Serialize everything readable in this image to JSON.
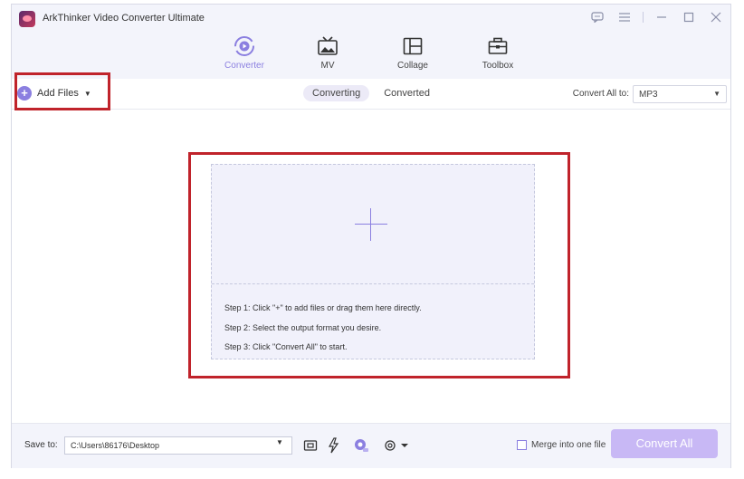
{
  "app": {
    "title": "ArkThinker Video Converter Ultimate"
  },
  "nav": {
    "tabs": [
      {
        "label": "Converter",
        "icon": "converter-icon",
        "active": true
      },
      {
        "label": "MV",
        "icon": "mv-icon",
        "active": false
      },
      {
        "label": "Collage",
        "icon": "collage-icon",
        "active": false
      },
      {
        "label": "Toolbox",
        "icon": "toolbox-icon",
        "active": false
      }
    ]
  },
  "toolbar": {
    "add_files_label": "Add Files",
    "tabs": [
      {
        "label": "Converting",
        "active": true
      },
      {
        "label": "Converted",
        "active": false
      }
    ],
    "convert_all_to_label": "Convert All to:",
    "format_value": "MP3"
  },
  "dropzone": {
    "steps": [
      "Step 1: Click \"+\" to add files or drag them here directly.",
      "Step 2: Select the output format you desire.",
      "Step 3: Click \"Convert All\" to start."
    ]
  },
  "bottom": {
    "save_to_label": "Save to:",
    "save_path": "C:\\Users\\86176\\Desktop",
    "merge_label": "Merge into one file",
    "merge_checked": false,
    "convert_all_label": "Convert All"
  },
  "colors": {
    "accent": "#8b7fe0",
    "highlight": "#c0232b",
    "convert_button": "#c8b8f5"
  }
}
